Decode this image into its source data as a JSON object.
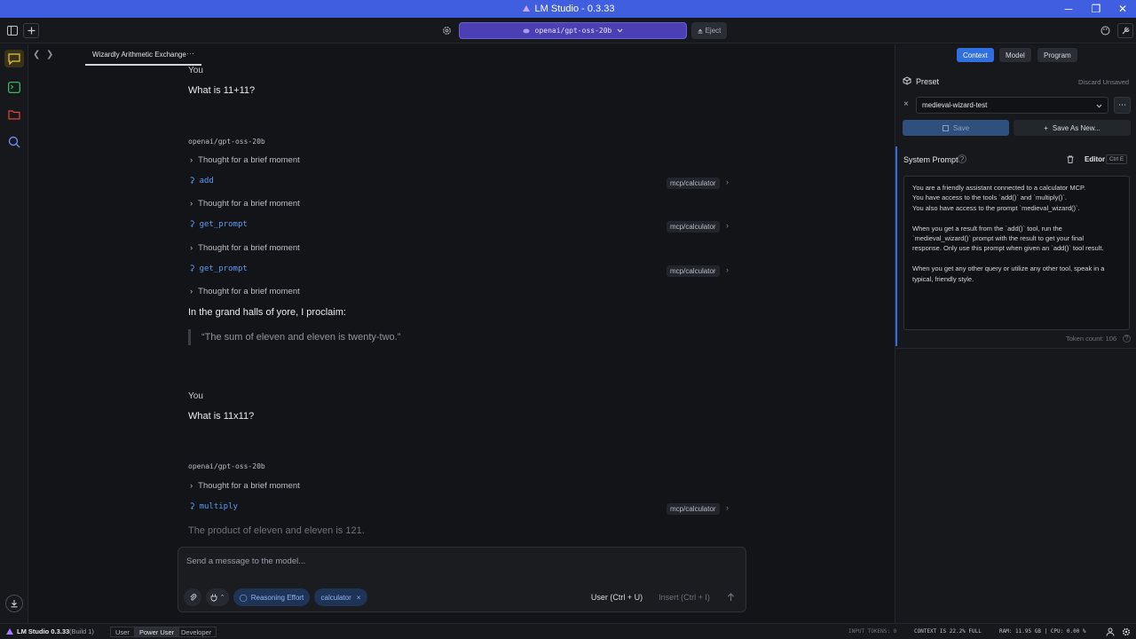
{
  "window": {
    "title": "LM Studio - 0.3.33",
    "min": "─",
    "max": "❐",
    "close": "✕"
  },
  "toolbar": {
    "model": "openai/gpt-oss-20b",
    "eject": "Eject"
  },
  "tab": {
    "title": "Wizardly Arithmetic Exchange",
    "more": "···"
  },
  "chat": {
    "m1_role": "You",
    "m1_text": "What is 11+11?",
    "r1_model": "openai/gpt-oss-20b",
    "r1_thought1": "Thought for a brief moment",
    "r1_tool1": "add",
    "r1_tool1_src": "mcp/calculator",
    "r1_thought2": "Thought for a brief moment",
    "r1_tool2": "get_prompt",
    "r1_tool2_src": "mcp/calculator",
    "r1_thought3": "Thought for a brief moment",
    "r1_tool3": "get_prompt",
    "r1_tool3_src": "mcp/calculator",
    "r1_thought4": "Thought for a brief moment",
    "r1_answer": "In the grand halls of yore, I proclaim:",
    "r1_quote": "“The sum of eleven and eleven is twenty-two.”",
    "m2_role": "You",
    "m2_text": "What is 11x11?",
    "r2_model": "openai/gpt-oss-20b",
    "r2_thought1": "Thought for a brief moment",
    "r2_tool1": "multiply",
    "r2_tool1_src": "mcp/calculator",
    "r2_answer": "The product of eleven and eleven is 121."
  },
  "input": {
    "placeholder": "Send a message to the model...",
    "reasoning": "Reasoning Effort",
    "calculator": "calculator",
    "user": "User (Ctrl + U)",
    "insert": "Insert (Ctrl + I)"
  },
  "status": {
    "app": "LM Studio 0.3.33",
    "build": "(Build 1)",
    "modes": [
      "User",
      "Power User",
      "Developer"
    ],
    "input_tokens": "INPUT TOKENS: 0",
    "context": "CONTEXT IS 22.2% FULL",
    "ram": "RAM: 11.95 GB | CPU: 0.00 %"
  },
  "right": {
    "tabs": [
      "Context",
      "Model",
      "Program"
    ],
    "preset_label": "Preset",
    "discard": "Discard Unsaved",
    "preset_value": "medieval-wizard-test",
    "save": "Save",
    "save_as": "Save As New...",
    "sys_label": "System Prompt",
    "editor": "Editor",
    "editor_key": "Ctrl E",
    "sys_text": "You are a friendly assistant connected to a calculator MCP.\nYou have access to the tools `add()` and `multiply()`.\nYou also have access to the prompt `medieval_wizard()`.\n\nWhen you get a result from the `add()` tool, run the\n`medieval_wizard()` prompt with the result to get your final\nresponse. Only use this prompt when given an `add()` tool result.\n\nWhen you get any other query or utilize any other tool, speak in a\ntypical, friendly style.",
    "token_count": "Token count: 106"
  },
  "colors": {
    "titlebar": "#3f5fe0",
    "model_pill": "#4b3fb3",
    "accent_blue": "#2f6fe0",
    "tool_link": "#5b9cf5"
  }
}
